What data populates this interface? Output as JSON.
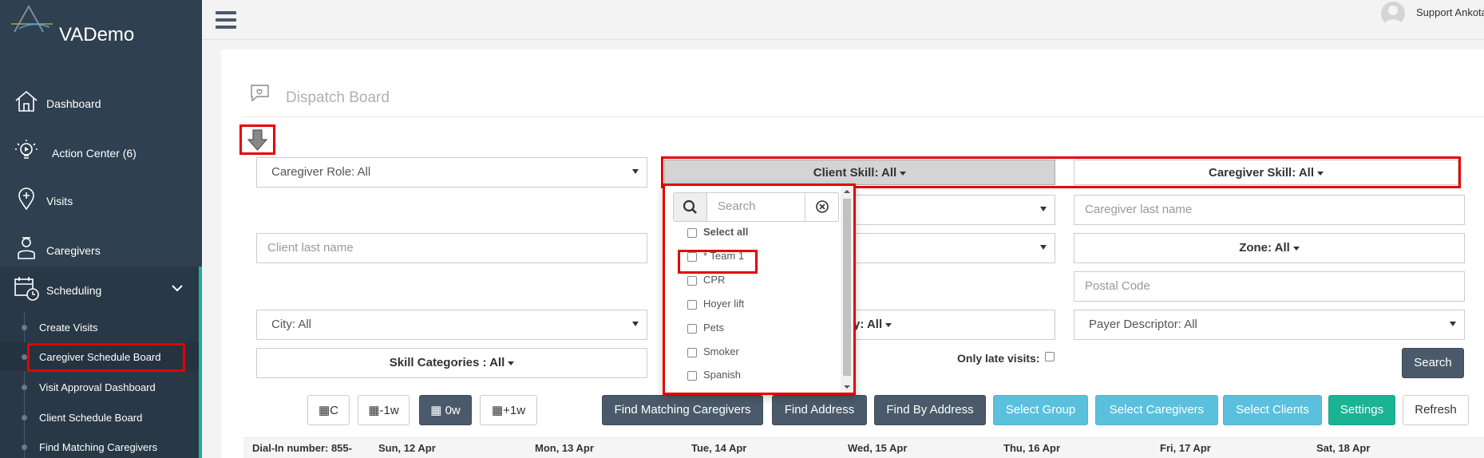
{
  "app": {
    "name": "VADemo"
  },
  "sidebar": {
    "items": [
      {
        "label": "Dashboard",
        "icon": "home-icon"
      },
      {
        "label": "Action Center (6)",
        "icon": "lightbulb-icon"
      },
      {
        "label": "Visits",
        "icon": "map-pin-icon"
      },
      {
        "label": "Caregivers",
        "icon": "caregiver-icon"
      },
      {
        "label": "Scheduling",
        "icon": "calendar-clock-icon"
      }
    ],
    "sub_items": [
      {
        "label": "Create Visits"
      },
      {
        "label": "Caregiver Schedule Board"
      },
      {
        "label": "Visit Approval Dashboard"
      },
      {
        "label": "Client Schedule Board"
      },
      {
        "label": "Find Matching Caregivers"
      }
    ]
  },
  "header": {
    "user_name": "Support Ankota"
  },
  "page": {
    "title": "Dispatch Board"
  },
  "filters": {
    "caregiver_role": "Caregiver Role: All",
    "client_skill": "Client Skill: All",
    "caregiver_skill": "Caregiver Skill: All",
    "caregiver_last_name_placeholder": "Caregiver last name",
    "client_last_name_placeholder": "Client last name",
    "zone": "Zone: All",
    "postal_code_placeholder": "Postal Code",
    "city": "City: All",
    "partial_all": "y: All",
    "payer_descriptor": "Payer Descriptor: All",
    "skill_categories": "Skill Categories : All",
    "only_late_visits": "Only late visits:",
    "search_label": "Search"
  },
  "client_skill_dropdown": {
    "search_placeholder": "Search",
    "options": [
      "Select all",
      "* Team 1",
      "CPR",
      "Hoyer lift",
      "Pets",
      "Smoker",
      "Spanish"
    ]
  },
  "toolbar": {
    "nav_c": "C",
    "nav_minus": "-1w",
    "nav_zero": "0w",
    "nav_plus": "+1w",
    "find_matching": "Find Matching Caregivers",
    "find_address": "Find Address",
    "find_by_address": "Find By Address",
    "select_group": "Select Group",
    "select_caregivers": "Select Caregivers",
    "select_clients": "Select Clients",
    "settings": "Settings",
    "refresh": "Refresh"
  },
  "calendar": {
    "headers": [
      "Dial-In number: 855-",
      "Sun, 12 Apr",
      "Mon, 13 Apr",
      "Tue, 14 Apr",
      "Wed, 15 Apr",
      "Thu, 16 Apr",
      "Fri, 17 Apr",
      "Sat, 18 Apr"
    ]
  },
  "colors": {
    "sidebar_bg": "#2f4050",
    "accent_green": "#1ab394",
    "highlight_red": "#e60000",
    "button_dark": "#4a5a6a",
    "button_info": "#5bc0de"
  }
}
